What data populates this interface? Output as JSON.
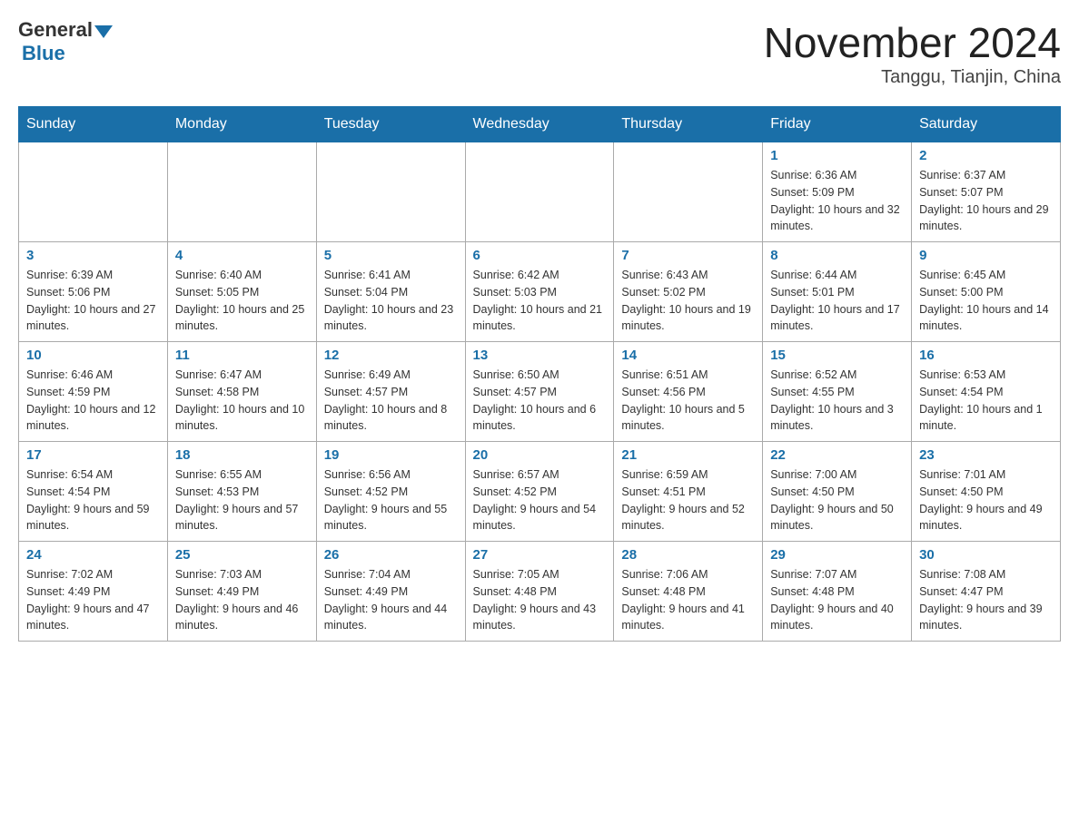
{
  "header": {
    "logo_general": "General",
    "logo_blue": "Blue",
    "month_title": "November 2024",
    "location": "Tanggu, Tianjin, China"
  },
  "days_of_week": [
    "Sunday",
    "Monday",
    "Tuesday",
    "Wednesday",
    "Thursday",
    "Friday",
    "Saturday"
  ],
  "weeks": [
    [
      {
        "day": "",
        "info": ""
      },
      {
        "day": "",
        "info": ""
      },
      {
        "day": "",
        "info": ""
      },
      {
        "day": "",
        "info": ""
      },
      {
        "day": "",
        "info": ""
      },
      {
        "day": "1",
        "info": "Sunrise: 6:36 AM\nSunset: 5:09 PM\nDaylight: 10 hours and 32 minutes."
      },
      {
        "day": "2",
        "info": "Sunrise: 6:37 AM\nSunset: 5:07 PM\nDaylight: 10 hours and 29 minutes."
      }
    ],
    [
      {
        "day": "3",
        "info": "Sunrise: 6:39 AM\nSunset: 5:06 PM\nDaylight: 10 hours and 27 minutes."
      },
      {
        "day": "4",
        "info": "Sunrise: 6:40 AM\nSunset: 5:05 PM\nDaylight: 10 hours and 25 minutes."
      },
      {
        "day": "5",
        "info": "Sunrise: 6:41 AM\nSunset: 5:04 PM\nDaylight: 10 hours and 23 minutes."
      },
      {
        "day": "6",
        "info": "Sunrise: 6:42 AM\nSunset: 5:03 PM\nDaylight: 10 hours and 21 minutes."
      },
      {
        "day": "7",
        "info": "Sunrise: 6:43 AM\nSunset: 5:02 PM\nDaylight: 10 hours and 19 minutes."
      },
      {
        "day": "8",
        "info": "Sunrise: 6:44 AM\nSunset: 5:01 PM\nDaylight: 10 hours and 17 minutes."
      },
      {
        "day": "9",
        "info": "Sunrise: 6:45 AM\nSunset: 5:00 PM\nDaylight: 10 hours and 14 minutes."
      }
    ],
    [
      {
        "day": "10",
        "info": "Sunrise: 6:46 AM\nSunset: 4:59 PM\nDaylight: 10 hours and 12 minutes."
      },
      {
        "day": "11",
        "info": "Sunrise: 6:47 AM\nSunset: 4:58 PM\nDaylight: 10 hours and 10 minutes."
      },
      {
        "day": "12",
        "info": "Sunrise: 6:49 AM\nSunset: 4:57 PM\nDaylight: 10 hours and 8 minutes."
      },
      {
        "day": "13",
        "info": "Sunrise: 6:50 AM\nSunset: 4:57 PM\nDaylight: 10 hours and 6 minutes."
      },
      {
        "day": "14",
        "info": "Sunrise: 6:51 AM\nSunset: 4:56 PM\nDaylight: 10 hours and 5 minutes."
      },
      {
        "day": "15",
        "info": "Sunrise: 6:52 AM\nSunset: 4:55 PM\nDaylight: 10 hours and 3 minutes."
      },
      {
        "day": "16",
        "info": "Sunrise: 6:53 AM\nSunset: 4:54 PM\nDaylight: 10 hours and 1 minute."
      }
    ],
    [
      {
        "day": "17",
        "info": "Sunrise: 6:54 AM\nSunset: 4:54 PM\nDaylight: 9 hours and 59 minutes."
      },
      {
        "day": "18",
        "info": "Sunrise: 6:55 AM\nSunset: 4:53 PM\nDaylight: 9 hours and 57 minutes."
      },
      {
        "day": "19",
        "info": "Sunrise: 6:56 AM\nSunset: 4:52 PM\nDaylight: 9 hours and 55 minutes."
      },
      {
        "day": "20",
        "info": "Sunrise: 6:57 AM\nSunset: 4:52 PM\nDaylight: 9 hours and 54 minutes."
      },
      {
        "day": "21",
        "info": "Sunrise: 6:59 AM\nSunset: 4:51 PM\nDaylight: 9 hours and 52 minutes."
      },
      {
        "day": "22",
        "info": "Sunrise: 7:00 AM\nSunset: 4:50 PM\nDaylight: 9 hours and 50 minutes."
      },
      {
        "day": "23",
        "info": "Sunrise: 7:01 AM\nSunset: 4:50 PM\nDaylight: 9 hours and 49 minutes."
      }
    ],
    [
      {
        "day": "24",
        "info": "Sunrise: 7:02 AM\nSunset: 4:49 PM\nDaylight: 9 hours and 47 minutes."
      },
      {
        "day": "25",
        "info": "Sunrise: 7:03 AM\nSunset: 4:49 PM\nDaylight: 9 hours and 46 minutes."
      },
      {
        "day": "26",
        "info": "Sunrise: 7:04 AM\nSunset: 4:49 PM\nDaylight: 9 hours and 44 minutes."
      },
      {
        "day": "27",
        "info": "Sunrise: 7:05 AM\nSunset: 4:48 PM\nDaylight: 9 hours and 43 minutes."
      },
      {
        "day": "28",
        "info": "Sunrise: 7:06 AM\nSunset: 4:48 PM\nDaylight: 9 hours and 41 minutes."
      },
      {
        "day": "29",
        "info": "Sunrise: 7:07 AM\nSunset: 4:48 PM\nDaylight: 9 hours and 40 minutes."
      },
      {
        "day": "30",
        "info": "Sunrise: 7:08 AM\nSunset: 4:47 PM\nDaylight: 9 hours and 39 minutes."
      }
    ]
  ]
}
